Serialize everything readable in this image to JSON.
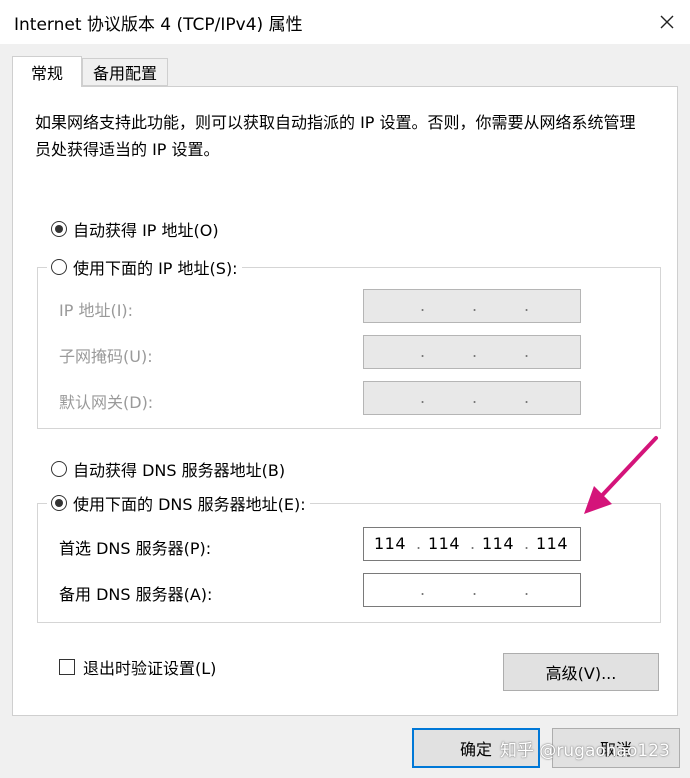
{
  "window": {
    "title": "Internet 协议版本 4 (TCP/IPv4) 属性"
  },
  "tabs": [
    {
      "label": "常规"
    },
    {
      "label": "备用配置"
    }
  ],
  "description": "如果网络支持此功能，则可以获取自动指派的 IP 设置。否则，你需要从网络系统管理员处获得适当的 IP 设置。",
  "ip": {
    "auto_label": "自动获得 IP 地址(O)",
    "manual_label": "使用下面的 IP 地址(S):",
    "address_label": "IP 地址(I):",
    "subnet_label": "子网掩码(U):",
    "gateway_label": "默认网关(D):"
  },
  "dns": {
    "auto_label": "自动获得 DNS 服务器地址(B)",
    "manual_label": "使用下面的 DNS 服务器地址(E):",
    "preferred_label": "首选 DNS 服务器(P):",
    "preferred_value": [
      "114",
      "114",
      "114",
      "114"
    ],
    "alternate_label": "备用 DNS 服务器(A):"
  },
  "validate_label": "退出时验证设置(L)",
  "buttons": {
    "advanced": "高级(V)...",
    "ok": "确定",
    "cancel": "取消"
  },
  "watermark": "知乎 @rugaohao123",
  "colors": {
    "arrow": "#d4147a",
    "default_button_border": "#0078d7"
  },
  "icons": {
    "close": "close-icon"
  }
}
